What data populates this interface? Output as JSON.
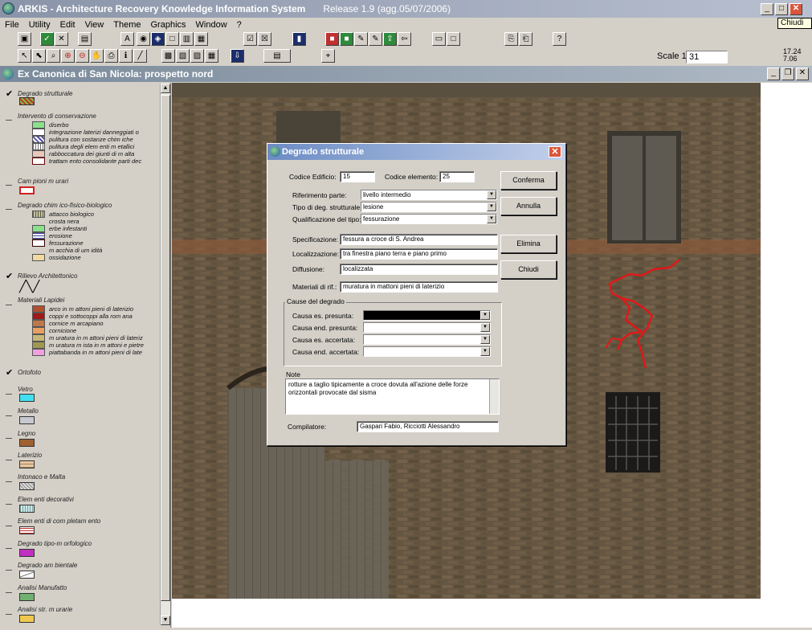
{
  "app": {
    "title": "ARKIS - Architecture Recovery Knowledge Information System",
    "release": "Release 1.9  (agg.05/07/2006)",
    "tooltip": "Chiudi"
  },
  "menu": [
    "File",
    "Utility",
    "Edit",
    "View",
    "Theme",
    "Graphics",
    "Window",
    "?"
  ],
  "scale": {
    "label": "Scale 1:",
    "value": "31"
  },
  "coords": {
    "x": "17.24",
    "y": "7.06"
  },
  "document": {
    "title": "Ex Canonica di San Nicola: prospetto nord"
  },
  "legend": {
    "groups": [
      {
        "label": "Degrado strutturale",
        "checked": true,
        "items": []
      },
      {
        "label": "Intervento di conservazione",
        "checked": false,
        "items": [
          {
            "label": "diserbo",
            "color": "#8be08b"
          },
          {
            "label": "integrazione laterizi danneggiati o",
            "color": "#ffffff"
          },
          {
            "label": "pulitura con sostanze chim iche",
            "color": "#9090b8"
          },
          {
            "label": "pulitura degli elem enti m etallici",
            "color": "#d8d8e0"
          },
          {
            "label": "rabboccatura dei giunti di m alta",
            "color": "#e8c8b8"
          },
          {
            "label": "trattam ento consolidante parti dec",
            "color": "#ffffff"
          }
        ]
      },
      {
        "label": "Cam pioni m urari",
        "checked": false,
        "items": []
      },
      {
        "label": "Degrado chim ico-fisico-biologico",
        "checked": false,
        "items": [
          {
            "label": "attacco biologico",
            "color": "#c0c0a0"
          },
          {
            "label": "crosta nera",
            "color": "#d4d0c8"
          },
          {
            "label": "erbe infestanti",
            "color": "#8be08b"
          },
          {
            "label": "erosione",
            "color": "#c8c8e8"
          },
          {
            "label": "fessurazione",
            "color": "#ffffff"
          },
          {
            "label": "m acchia di um idità",
            "color": "#d4d0c8"
          },
          {
            "label": "ossidazione",
            "color": "#f0d8a0"
          }
        ]
      },
      {
        "label": "Rilievo Architettonico",
        "checked": true,
        "items": []
      },
      {
        "label": "Materiali Lapidei",
        "checked": false,
        "items": [
          {
            "label": "arco in m attoni pieni di laterizio",
            "color": "#b05030"
          },
          {
            "label": "coppi e sottocoppi alla rom ana",
            "color": "#a01818"
          },
          {
            "label": "cornice m arcapiano",
            "color": "#c07848"
          },
          {
            "label": "cornicione",
            "color": "#e8a060"
          },
          {
            "label": "m uratura in m attoni pieni di lateriz",
            "color": "#c8b878"
          },
          {
            "label": "m uratura m ista in m attoni e pietre",
            "color": "#a09850"
          },
          {
            "label": "piattabanda in m attoni pieni di late",
            "color": "#f0a0e0"
          }
        ]
      },
      {
        "label": "Ortofoto",
        "checked": true,
        "items": []
      },
      {
        "label": "Vetro",
        "checked": false,
        "color": "#40e0f0",
        "items": []
      },
      {
        "label": "Metallo",
        "checked": false,
        "color": "#c8c8d0",
        "items": []
      },
      {
        "label": "Legno",
        "checked": false,
        "color": "#a06030",
        "items": []
      },
      {
        "label": "Laterizio",
        "checked": false,
        "color": "#e8c8a0",
        "items": []
      },
      {
        "label": "Intonaco e Malta",
        "checked": false,
        "color": "#d8d8d8",
        "items": []
      },
      {
        "label": "Elem enti decorativi",
        "checked": false,
        "color": "#c8e8e8",
        "items": []
      },
      {
        "label": "Elem enti di com pletam ento",
        "checked": false,
        "color": "#c03030",
        "items": []
      },
      {
        "label": "Degrado tipo-m orfologico",
        "checked": false,
        "color": "#c030c0",
        "items": []
      },
      {
        "label": "Degrado am bientale",
        "checked": false,
        "color": "#ffffff",
        "items": []
      },
      {
        "label": "Analisi Manufatto",
        "checked": false,
        "color": "#70b070",
        "items": []
      },
      {
        "label": "Analisi str. m urarie",
        "checked": false,
        "color": "#f0c850",
        "items": []
      }
    ]
  },
  "dialog": {
    "title": "Degrado strutturale",
    "codice_edificio": {
      "label": "Codice Edificio:",
      "value": "15"
    },
    "codice_elemento": {
      "label": "Codice elemento:",
      "value": "25"
    },
    "riferimento": {
      "label": "Riferimento parte:",
      "value": "livello intermedio"
    },
    "tipo": {
      "label": "Tipo di deg. strutturale:",
      "value": "lesione"
    },
    "qualificazione": {
      "label": "Qualificazione del tipo:",
      "value": "fessurazione"
    },
    "specificazione": {
      "label": "Specificazione:",
      "value": "fessura a croce di S. Andrea"
    },
    "localizzazione": {
      "label": "Localizzazione:",
      "value": "tra finestra piano terra e piano primo"
    },
    "diffusione": {
      "label": "Diffusione:",
      "value": "localizzata"
    },
    "materiali": {
      "label": "Materiali di rif.:",
      "value": "muratura in mattoni pieni di laterizio"
    },
    "cause": {
      "title": "Cause del degrado",
      "es_presunta": {
        "label": "Causa es. presunta:",
        "value": ""
      },
      "end_presunta": {
        "label": "Causa end. presunta:",
        "value": ""
      },
      "es_accertata": {
        "label": "Causa es. accertata:",
        "value": ""
      },
      "end_accertata": {
        "label": "Causa end. accertata:",
        "value": ""
      }
    },
    "note": {
      "label": "Note",
      "value": "rotture a taglio tipicamente a croce dovuta all'azione delle forze orizzontali provocate dal sisma"
    },
    "compilatore": {
      "label": "Compilatore:",
      "value": "Gaspari Fabio, Ricciotti Alessandro"
    },
    "buttons": {
      "conferma": "Conferma",
      "annulla": "Annulla",
      "elimina": "Elimina",
      "chiudi": "Chiudi"
    }
  }
}
